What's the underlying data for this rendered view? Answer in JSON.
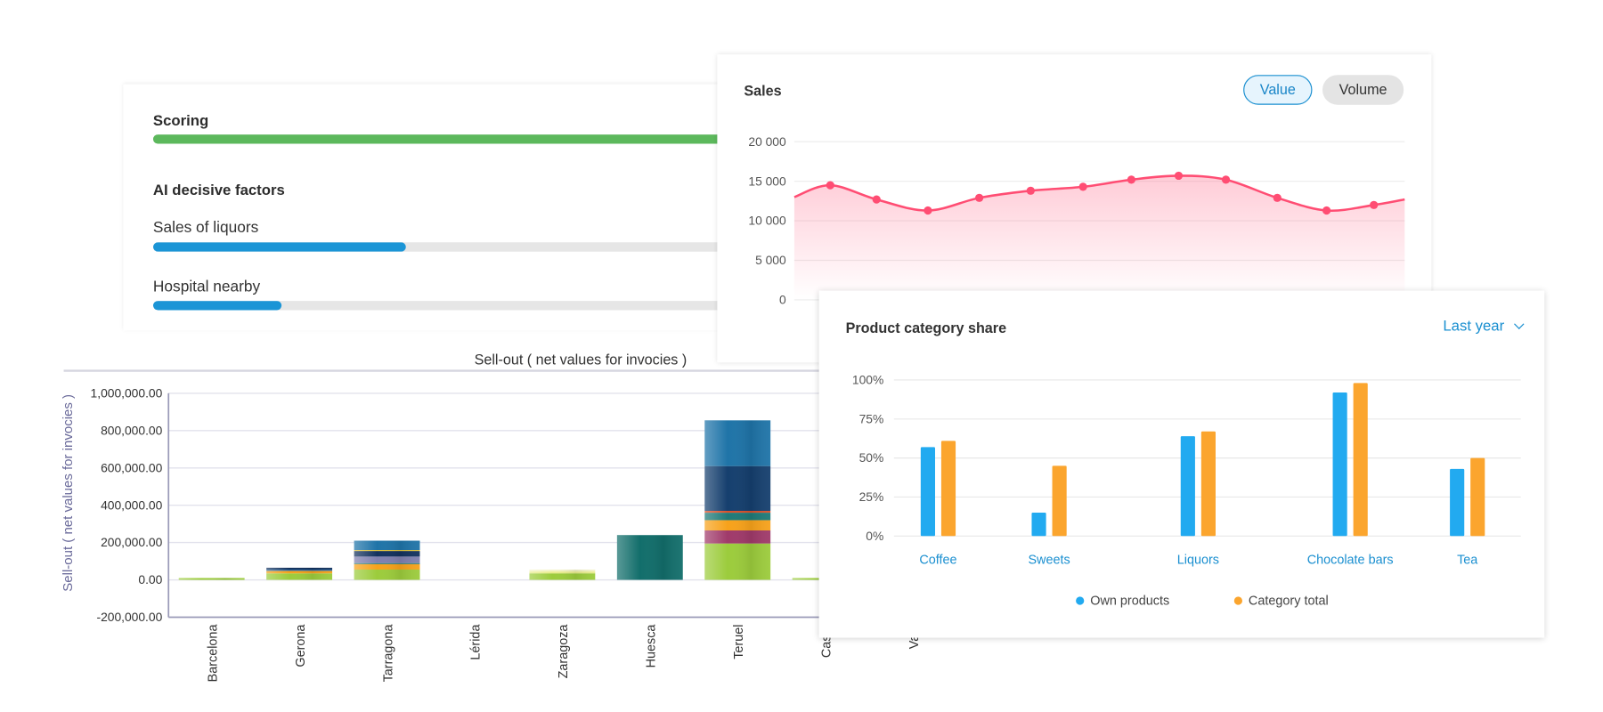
{
  "scoring": {
    "title": "Scoring",
    "score": 1.0,
    "score_color": "#5cb85c",
    "factors_title": "AI decisive factors",
    "factors": [
      {
        "label": "Sales of liquors",
        "value": 0.65
      },
      {
        "label": "Hospital nearby",
        "value": 0.33
      }
    ],
    "factor_color": "#1b95d6"
  },
  "sales": {
    "title": "Sales",
    "toggle": {
      "value_label": "Value",
      "volume_label": "Volume",
      "active": "Value"
    }
  },
  "share": {
    "title": "Product category share",
    "period_label": "Last year",
    "period_icon": "chevron-down-icon"
  },
  "chart_data": [
    {
      "type": "area",
      "title": "Sales",
      "ylim": [
        0,
        20000
      ],
      "yticks": [
        "20 000",
        "15 000",
        "10 000",
        "5 000",
        "0"
      ],
      "ytick_values": [
        20000,
        15000,
        10000,
        5000,
        0
      ],
      "grid": true,
      "color": "#ff4d73",
      "line_start": 13000,
      "line_end": 12700,
      "values": [
        14500,
        12700,
        11300,
        12900,
        13800,
        14300,
        15200,
        15700,
        15200,
        12900,
        11300,
        12000
      ]
    },
    {
      "type": "bar",
      "title": "",
      "ylim": [
        0,
        100
      ],
      "yticks": [
        "100%",
        "75%",
        "50%",
        "25%",
        "0%"
      ],
      "ytick_values": [
        100,
        75,
        50,
        25,
        0
      ],
      "grid": true,
      "legend_placement": "bottom",
      "categories": [
        "Coffee",
        "Sweets",
        "Liquors",
        "Chocolate bars",
        "Tea"
      ],
      "series": [
        {
          "name": "Own products",
          "color": "#22aaf0",
          "values": [
            57,
            15,
            64,
            92,
            43
          ]
        },
        {
          "name": "Category total",
          "color": "#fba52e",
          "values": [
            61,
            45,
            67,
            98,
            50
          ]
        }
      ]
    },
    {
      "type": "bar",
      "stacked": true,
      "title": "Sell-out ( net values for invocies )",
      "ylabel": "Sell-out ( net values for invocies )",
      "ylim": [
        -200000,
        1000000
      ],
      "yticks": [
        "1,000,000.00",
        "800,000.00",
        "600,000.00",
        "400,000.00",
        "200,000.00",
        "0.00",
        "-200,000.00"
      ],
      "ytick_values": [
        1000000,
        800000,
        600000,
        400000,
        200000,
        0,
        -200000
      ],
      "grid": true,
      "categories": [
        "Barcelona",
        "Gerona",
        "Tarragona",
        "Lérida",
        "Zaragoza",
        "Huesca",
        "Teruel",
        "Caste",
        "Vale"
      ],
      "stacks": [
        [
          {
            "value": 10000,
            "color": "#9ccc3c"
          }
        ],
        [
          {
            "value": 35000,
            "color": "#9ccc3c"
          },
          {
            "value": 13000,
            "color": "#f7a21b"
          },
          {
            "value": 7000,
            "color": "#2e6da4"
          },
          {
            "value": 10000,
            "color": "#13325e"
          }
        ],
        [
          {
            "value": 55000,
            "color": "#9ccc3c"
          },
          {
            "value": 30000,
            "color": "#f7a21b"
          },
          {
            "value": 5000,
            "color": "#1f7a78"
          },
          {
            "value": 35000,
            "color": "#7f80b0"
          },
          {
            "value": 30000,
            "color": "#13325e"
          },
          {
            "value": 5000,
            "color": "#e0c33b"
          },
          {
            "value": 50000,
            "color": "#1f74a8"
          }
        ],
        [],
        [
          {
            "value": 35000,
            "color": "#9ccc3c"
          },
          {
            "value": 10000,
            "color": "#e8ec8a"
          },
          {
            "value": 10000,
            "color": "#f3f3c6"
          }
        ],
        [
          {
            "value": 240000,
            "color": "#126e6b"
          }
        ],
        [
          {
            "value": 195000,
            "color": "#9ccc3c"
          },
          {
            "value": 70000,
            "color": "#a03a6a"
          },
          {
            "value": 55000,
            "color": "#f7a21b"
          },
          {
            "value": 40000,
            "color": "#1f7a78"
          },
          {
            "value": 10000,
            "color": "#d9502a"
          },
          {
            "value": 240000,
            "color": "#153f6e"
          },
          {
            "value": 245000,
            "color": "#1f74a8"
          }
        ],
        [
          {
            "value": 10000,
            "color": "#9ccc3c"
          }
        ],
        []
      ],
      "axis_label_color": "#6a6a9a"
    }
  ]
}
